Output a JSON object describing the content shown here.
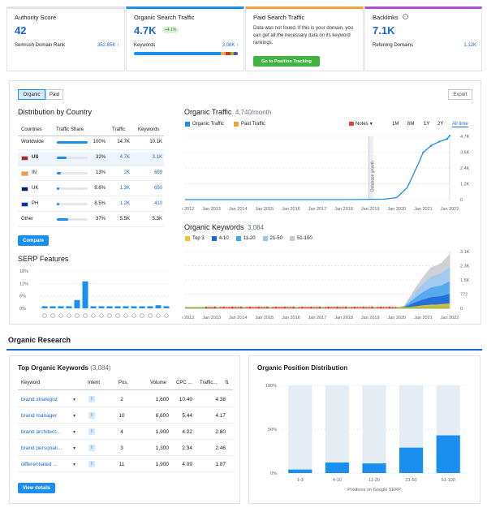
{
  "top": {
    "authority": {
      "title": "Authority Score",
      "value": "42",
      "sub_label": "Semrush Domain Rank",
      "sub_value": "352.85K ↑"
    },
    "organic": {
      "title": "Organic Search Traffic",
      "value": "4.7K",
      "badge": "+4.1%",
      "sub_label": "Keywords",
      "sub_value": "3.08K ↑"
    },
    "paid": {
      "title": "Paid Search Traffic",
      "message": "Data was not found. If this is your domain, you can get all the necessary data on its keyword rankings.",
      "button": "Go to Position Tracking"
    },
    "backlinks": {
      "title": "Backlinks",
      "value": "7.1K",
      "sub_label": "Referring Domains",
      "sub_value": "1.12K"
    }
  },
  "overview": {
    "toggle": {
      "organic": "Organic",
      "paid": "Paid"
    },
    "export": "Export",
    "distribution": {
      "title": "Distribution by Country",
      "headers": [
        "Countries",
        "Traffic Share",
        "Traffic",
        "Keywords"
      ],
      "rows": [
        {
          "country": "Worldwide",
          "share": "100%",
          "fraction": 1.0,
          "traffic": "14.7K",
          "keywords": "10.1K"
        },
        {
          "country": "US",
          "share": "32%",
          "fraction": 0.32,
          "traffic": "4.7K",
          "keywords": "3.1K"
        },
        {
          "country": "IN",
          "share": "13%",
          "fraction": 0.13,
          "traffic": "2K",
          "keywords": "669"
        },
        {
          "country": "UK",
          "share": "8.6%",
          "fraction": 0.086,
          "traffic": "1.3K",
          "keywords": "650"
        },
        {
          "country": "PH",
          "share": "8.5%",
          "fraction": 0.085,
          "traffic": "1.2K",
          "keywords": "410"
        },
        {
          "country": "Other",
          "share": "37%",
          "fraction": 0.37,
          "traffic": "5.5K",
          "keywords": "5.3K"
        }
      ],
      "compare": "Compare"
    },
    "serp": {
      "title": "SERP Features",
      "yticks": [
        "18%",
        "12%",
        "6%",
        "0%"
      ]
    },
    "traffic": {
      "title": "Organic Traffic",
      "value": "4,740/month",
      "legend": [
        "Organic Traffic",
        "Paid Traffic"
      ],
      "notes": "Notes",
      "ranges": [
        "1M",
        "6M",
        "1Y",
        "2Y",
        "All time"
      ],
      "annotation": "Database growth",
      "yticks": [
        "4.7K",
        "3.6K",
        "2.4K",
        "1.2K",
        "0"
      ],
      "xticks": [
        "Jan 2012",
        "Jan 2013",
        "Jan 2014",
        "Jan 2015",
        "Jan 2016",
        "Jan 2017",
        "Jan 2018",
        "Jan 2019",
        "Jan 2020",
        "Jan 2021",
        "Jan 2022"
      ]
    },
    "keywords": {
      "title": "Organic Keywords",
      "value": "3,084",
      "legend": [
        "Top 3",
        "4-10",
        "11-20",
        "21-50",
        "51-100"
      ],
      "yticks": [
        "3.1K",
        "2.3K",
        "1.5K",
        "772",
        "0"
      ],
      "xticks": [
        "Jan 2012",
        "Jan 2013",
        "Jan 2014",
        "Jan 2015",
        "Jan 2016",
        "Jan 2017",
        "Jan 2018",
        "Jan 2019",
        "Jan 2020",
        "Jan 2021",
        "Jan 2022"
      ]
    }
  },
  "research": {
    "title": "Organic Research",
    "top_keywords": {
      "title": "Top Organic Keywords",
      "count": "(3,084)",
      "headers": [
        "Keyword",
        "Intent",
        "Pos.",
        "Volume",
        "CPC ...",
        "Traffic..."
      ],
      "rows": [
        {
          "keyword": "brand strategist",
          "intent": "I",
          "pos": "2",
          "volume": "1,600",
          "cpc": "10.40",
          "traffic": "4.38"
        },
        {
          "keyword": "brand manager",
          "intent": "I",
          "pos": "10",
          "volume": "6,600",
          "cpc": "5.44",
          "traffic": "4.17"
        },
        {
          "keyword": "brand architect...",
          "intent": "I",
          "pos": "4",
          "volume": "1,900",
          "cpc": "4.22",
          "traffic": "2.80"
        },
        {
          "keyword": "brand personali...",
          "intent": "I",
          "pos": "3",
          "volume": "1,300",
          "cpc": "2.34",
          "traffic": "2.46"
        },
        {
          "keyword": "differentiated ...",
          "intent": "I",
          "pos": "11",
          "volume": "1,900",
          "cpc": "4.09",
          "traffic": "1.87"
        }
      ],
      "button": "View details"
    },
    "position_dist": {
      "title": "Organic Position Distribution"
    }
  },
  "colors": {
    "accent": "#1a8ff0",
    "link": "#1a69d6",
    "green": "#3fb43f"
  },
  "chart_data": [
    {
      "type": "bar",
      "title": "Organic Position Distribution",
      "xlabel": "Positions on Google SERP",
      "categories": [
        "1-3",
        "4-10",
        "11-20",
        "21-50",
        "51-100"
      ],
      "values": [
        4,
        12,
        11,
        29,
        43
      ],
      "yticks": [
        "100%",
        "50%",
        "0%"
      ],
      "ylim": [
        0,
        100
      ]
    },
    {
      "type": "bar",
      "title": "SERP Features",
      "values": [
        1,
        1,
        1,
        1,
        4,
        13,
        1,
        1,
        1,
        1,
        1,
        1,
        1,
        1,
        1.5,
        1
      ],
      "ylim": [
        0,
        18
      ]
    },
    {
      "type": "line",
      "title": "Organic Traffic",
      "x": [
        2012,
        2018,
        2019.5,
        2020,
        2020.4,
        2020.8,
        2021.0,
        2021.3,
        2021.6,
        2021.9,
        2022
      ],
      "values": [
        0,
        0,
        30,
        150,
        900,
        2600,
        3500,
        4000,
        4300,
        4500,
        4740
      ],
      "ylim": [
        0,
        4700
      ]
    }
  ]
}
